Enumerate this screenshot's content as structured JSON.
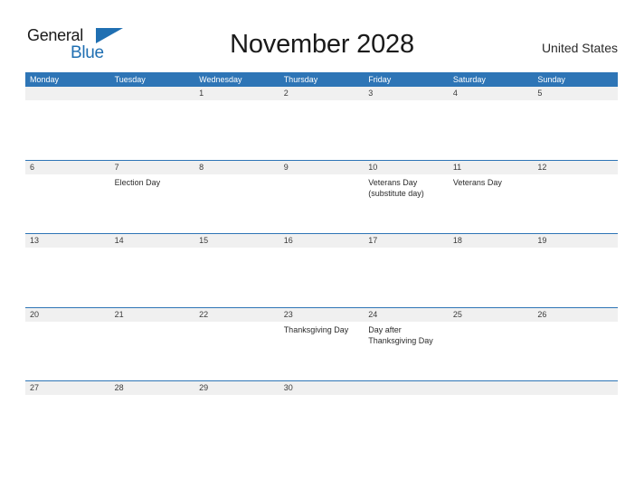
{
  "header": {
    "logo": {
      "line1": "General",
      "line2": "Blue",
      "triangle_icon": "blue-triangle-icon"
    },
    "title": "November 2028",
    "country": "United States"
  },
  "theme": {
    "header_blue": "#2E75B6",
    "logo_blue": "#1F6FB2",
    "row_band_gray": "#F0F0F0",
    "text_dark": "#2B2B2B",
    "page_background": "#FFFFFF"
  },
  "calendar": {
    "month": "November",
    "year": "2028",
    "weekday_headers": [
      "Monday",
      "Tuesday",
      "Wednesday",
      "Thursday",
      "Friday",
      "Saturday",
      "Sunday"
    ],
    "weeks": [
      {
        "days": [
          {
            "number": "",
            "events": []
          },
          {
            "number": "",
            "events": []
          },
          {
            "number": "1",
            "events": []
          },
          {
            "number": "2",
            "events": []
          },
          {
            "number": "3",
            "events": []
          },
          {
            "number": "4",
            "events": []
          },
          {
            "number": "5",
            "events": []
          }
        ]
      },
      {
        "days": [
          {
            "number": "6",
            "events": []
          },
          {
            "number": "7",
            "events": [
              "Election Day"
            ]
          },
          {
            "number": "8",
            "events": []
          },
          {
            "number": "9",
            "events": []
          },
          {
            "number": "10",
            "events": [
              "Veterans Day",
              "(substitute day)"
            ]
          },
          {
            "number": "11",
            "events": [
              "Veterans Day"
            ]
          },
          {
            "number": "12",
            "events": []
          }
        ]
      },
      {
        "days": [
          {
            "number": "13",
            "events": []
          },
          {
            "number": "14",
            "events": []
          },
          {
            "number": "15",
            "events": []
          },
          {
            "number": "16",
            "events": []
          },
          {
            "number": "17",
            "events": []
          },
          {
            "number": "18",
            "events": []
          },
          {
            "number": "19",
            "events": []
          }
        ]
      },
      {
        "days": [
          {
            "number": "20",
            "events": []
          },
          {
            "number": "21",
            "events": []
          },
          {
            "number": "22",
            "events": []
          },
          {
            "number": "23",
            "events": [
              "Thanksgiving Day"
            ]
          },
          {
            "number": "24",
            "events": [
              "Day after",
              "Thanksgiving Day"
            ]
          },
          {
            "number": "25",
            "events": []
          },
          {
            "number": "26",
            "events": []
          }
        ]
      },
      {
        "days": [
          {
            "number": "27",
            "events": []
          },
          {
            "number": "28",
            "events": []
          },
          {
            "number": "29",
            "events": []
          },
          {
            "number": "30",
            "events": []
          },
          {
            "number": "",
            "events": []
          },
          {
            "number": "",
            "events": []
          },
          {
            "number": "",
            "events": []
          }
        ]
      }
    ]
  }
}
